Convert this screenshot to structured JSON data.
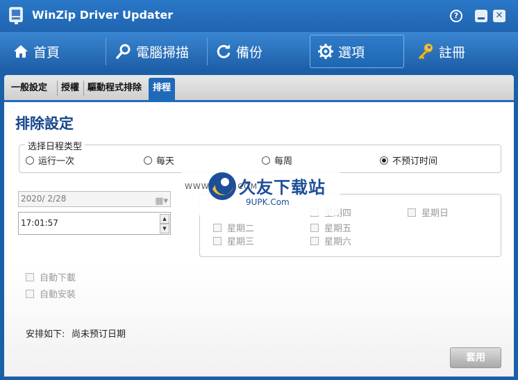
{
  "window": {
    "title": "WinZip Driver Updater",
    "help_label": "?",
    "close_label": "✕"
  },
  "nav": {
    "items": [
      {
        "label": "首頁",
        "icon": "home-icon"
      },
      {
        "label": "電腦掃描",
        "icon": "magnifier-icon"
      },
      {
        "label": "備份",
        "icon": "refresh-icon"
      },
      {
        "label": "選項",
        "icon": "gear-icon",
        "active": true
      },
      {
        "label": "註冊",
        "icon": "key-icon"
      }
    ]
  },
  "subtabs": [
    {
      "label": "一般設定"
    },
    {
      "label": "授權"
    },
    {
      "label": "驅動程式排除"
    },
    {
      "label": "排程",
      "active": true
    }
  ],
  "panel": {
    "heading": "排除設定",
    "schedule_type": {
      "legend": "选择日程类型",
      "options": [
        {
          "label": "运行一次",
          "selected": false
        },
        {
          "label": "每天",
          "selected": false
        },
        {
          "label": "每周",
          "selected": false
        },
        {
          "label": "不预订时间",
          "selected": true
        }
      ]
    },
    "date_value": "2020/  2/28",
    "time_value": "17:01:57",
    "weekdays": {
      "items": [
        {
          "label": "星期四"
        },
        {
          "label": "星期日"
        },
        {
          "label": "星期二"
        },
        {
          "label": "星期五"
        },
        {
          "label": "星期三"
        },
        {
          "label": "星期六"
        }
      ]
    },
    "auto_download": "自動下載",
    "auto_install": "自動安裝",
    "schedule_label": "安排如下:",
    "schedule_value": "尚未预订日期",
    "apply_label": "套用"
  },
  "watermark": {
    "url": "WWW.9UPK.COM",
    "name": "久友下载站",
    "domain": "9UPK.Com"
  },
  "colors": {
    "title_bar": "#1f64b0",
    "nav_bar": "#2a78c8",
    "active_tab": "#1f6ab8",
    "heading": "#16468a"
  }
}
